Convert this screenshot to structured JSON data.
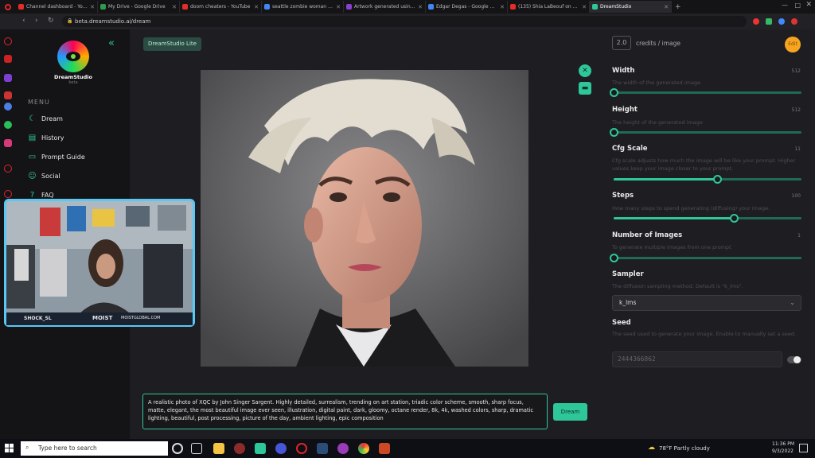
{
  "browser": {
    "tabs": [
      {
        "label": "Channel dashboard - YouTub",
        "color": "#e52d27"
      },
      {
        "label": "My Drive - Google Drive",
        "color": "#2d9b4e"
      },
      {
        "label": "doom cheaters - YouTube",
        "color": "#e52d27"
      },
      {
        "label": "seattle zombie woman - Go",
        "color": "#4285f4"
      },
      {
        "label": "Artwork generated using A",
        "color": "#8a3fd1"
      },
      {
        "label": "Edgar Degas - Google Sear",
        "color": "#4285f4"
      },
      {
        "label": "(135) Shia LaBeouf on REAL",
        "color": "#e52d27"
      },
      {
        "label": "DreamStudio",
        "color": "#2ec79a"
      }
    ],
    "url": "beta.dreamstudio.ai/dream"
  },
  "sidebar": {
    "brand": "DreamStudio",
    "brand_sub": "beta",
    "menu_label": "MENU",
    "items": [
      {
        "label": "Dream",
        "icon": "dream-icon"
      },
      {
        "label": "History",
        "icon": "history-icon"
      },
      {
        "label": "Prompt Guide",
        "icon": "guide-icon"
      },
      {
        "label": "Social",
        "icon": "social-icon"
      },
      {
        "label": "FAQ",
        "icon": "faq-icon"
      }
    ]
  },
  "header": {
    "lite_badge": "DreamStudio Lite",
    "credits_value": "2.0",
    "credits_label": "credits / image",
    "avatar": "Edit"
  },
  "params": {
    "width": {
      "title": "Width",
      "desc": "The width of the generated image",
      "value": "512",
      "level": 0.0
    },
    "height": {
      "title": "Height",
      "desc": "The height of the generated image",
      "value": "512",
      "level": 0.0
    },
    "cfg": {
      "title": "Cfg Scale",
      "desc": "Cfg scale adjusts how much the image will be like your prompt. Higher values keep your image closer to your prompt.",
      "value": "11",
      "level": 0.55
    },
    "steps": {
      "title": "Steps",
      "desc": "How many steps to spend generating (diffusing) your image.",
      "value": "100",
      "level": 0.64
    },
    "images": {
      "title": "Number of Images",
      "desc": "To generate multiple images from one prompt",
      "value": "1",
      "level": 0.0
    },
    "sampler": {
      "title": "Sampler",
      "desc": "The diffusion sampling method. Default is \"k_lms\".",
      "value": "k_lms"
    },
    "seed": {
      "title": "Seed",
      "desc": "The seed used to generate your image. Enable to manually set a seed.",
      "value": "2444366862"
    }
  },
  "prompt": {
    "text": "A realistic photo of XQC by John Singer Sargent. Highly detailed, surrealism, trending on art station, triadic color scheme, smooth, sharp focus, matte, elegant, the most beautiful image ever seen, illustration, digital paint, dark, gloomy, octane render, 8k, 4k, washed colors, sharp, dramatic lighting, beautiful, post processing, picture of the day, ambient lighting, epic composition",
    "button": "Dream"
  },
  "webcam": {
    "handle": "SHOCK_SL",
    "brand": "MOIST",
    "site": "MOISTGLOBAL.COM"
  },
  "taskbar": {
    "search_placeholder": "Type here to search",
    "weather": "78°F  Partly cloudy",
    "time": "11:36 PM",
    "date": "9/3/2022"
  }
}
